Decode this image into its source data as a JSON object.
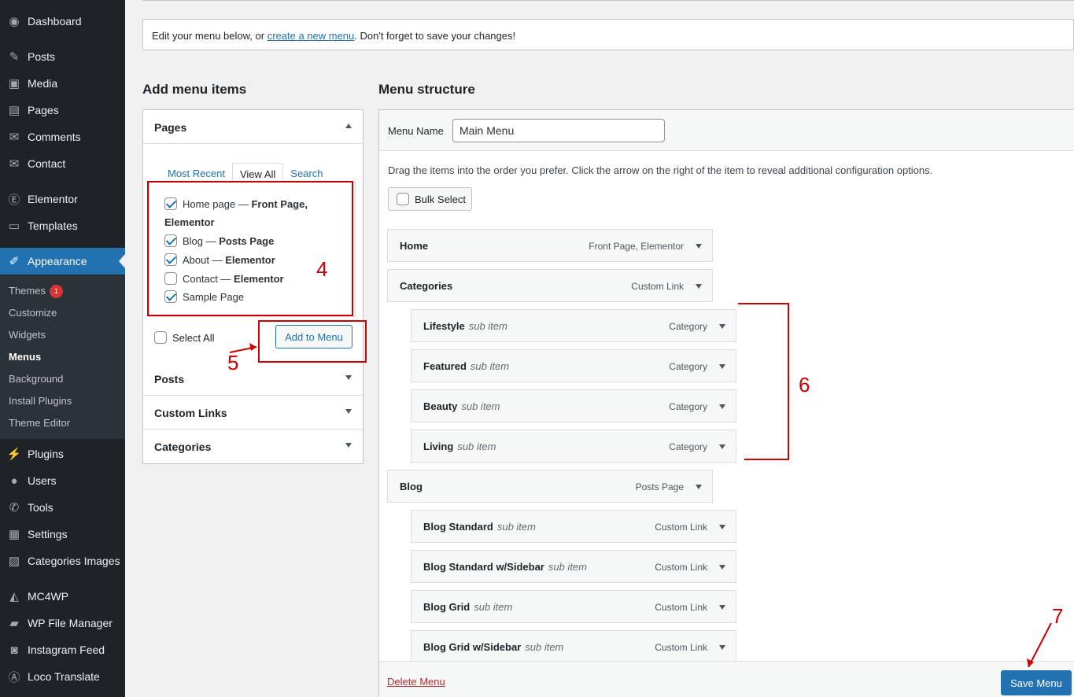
{
  "sidebar": {
    "items": [
      {
        "label": "Dashboard",
        "icon": "dashboard-icon",
        "glyph": "◉"
      },
      {
        "label": "Posts",
        "icon": "pin-icon",
        "glyph": "✎"
      },
      {
        "label": "Media",
        "icon": "media-icon",
        "glyph": "▣"
      },
      {
        "label": "Pages",
        "icon": "pages-icon",
        "glyph": "▤"
      },
      {
        "label": "Comments",
        "icon": "comment-icon",
        "glyph": "✉"
      },
      {
        "label": "Contact",
        "icon": "mail-icon",
        "glyph": "✉"
      },
      {
        "label": "Elementor",
        "icon": "elementor-icon",
        "glyph": "Ⓔ"
      },
      {
        "label": "Templates",
        "icon": "folder-icon",
        "glyph": "▭"
      },
      {
        "label": "Appearance",
        "icon": "brush-icon",
        "glyph": "✐"
      },
      {
        "label": "Plugins",
        "icon": "plugin-icon",
        "glyph": "⚡"
      },
      {
        "label": "Users",
        "icon": "user-icon",
        "glyph": "●"
      },
      {
        "label": "Tools",
        "icon": "wrench-icon",
        "glyph": "✆"
      },
      {
        "label": "Settings",
        "icon": "settings-icon",
        "glyph": "▦"
      },
      {
        "label": "Categories Images",
        "icon": "image-icon",
        "glyph": "▨"
      },
      {
        "label": "MC4WP",
        "icon": "mc4wp-icon",
        "glyph": "◭"
      },
      {
        "label": "WP File Manager",
        "icon": "file-manager-icon",
        "glyph": "▰"
      },
      {
        "label": "Instagram Feed",
        "icon": "camera-icon",
        "glyph": "◙"
      },
      {
        "label": "Loco Translate",
        "icon": "translate-icon",
        "glyph": "Ⓐ"
      }
    ],
    "submenu": [
      {
        "label": "Themes",
        "badge": "1"
      },
      {
        "label": "Customize"
      },
      {
        "label": "Widgets"
      },
      {
        "label": "Menus"
      },
      {
        "label": "Background"
      },
      {
        "label": "Install Plugins"
      },
      {
        "label": "Theme Editor"
      }
    ]
  },
  "notice": {
    "before": "Edit your menu below, or ",
    "link": "create a new menu",
    "after": ". Don't forget to save your changes!"
  },
  "add_items": {
    "heading": "Add menu items",
    "pages": {
      "title": "Pages",
      "tabs": [
        "Most Recent",
        "View All",
        "Search"
      ],
      "items": [
        {
          "name": "Home page",
          "suffix": "Front Page, Elementor",
          "checked": true
        },
        {
          "name": "Blog",
          "suffix": "Posts Page",
          "checked": true
        },
        {
          "name": "About",
          "suffix": "Elementor",
          "checked": true
        },
        {
          "name": "Contact",
          "suffix": "Elementor",
          "checked": false
        },
        {
          "name": "Sample Page",
          "suffix": "",
          "checked": true
        }
      ],
      "select_all": "Select All",
      "add_button": "Add to Menu"
    },
    "sections": [
      "Posts",
      "Custom Links",
      "Categories"
    ]
  },
  "structure": {
    "heading": "Menu structure",
    "name_label": "Menu Name",
    "name_value": "Main Menu",
    "instructions": "Drag the items into the order you prefer. Click the arrow on the right of the item to reveal additional configuration options.",
    "bulk_select": "Bulk Select",
    "sub_item_text": "sub item",
    "items": [
      {
        "title": "Home",
        "type": "Front Page, Elementor",
        "sub": false
      },
      {
        "title": "Categories",
        "type": "Custom Link",
        "sub": false
      },
      {
        "title": "Lifestyle",
        "type": "Category",
        "sub": true
      },
      {
        "title": "Featured",
        "type": "Category",
        "sub": true
      },
      {
        "title": "Beauty",
        "type": "Category",
        "sub": true
      },
      {
        "title": "Living",
        "type": "Category",
        "sub": true
      },
      {
        "title": "Blog",
        "type": "Posts Page",
        "sub": false
      },
      {
        "title": "Blog Standard",
        "type": "Custom Link",
        "sub": true
      },
      {
        "title": "Blog Standard w/Sidebar",
        "type": "Custom Link",
        "sub": true
      },
      {
        "title": "Blog Grid",
        "type": "Custom Link",
        "sub": true
      },
      {
        "title": "Blog Grid w/Sidebar",
        "type": "Custom Link",
        "sub": true
      }
    ],
    "delete_label": "Delete Menu",
    "save_label": "Save Menu"
  },
  "annotations": [
    "4",
    "5",
    "6",
    "7"
  ]
}
